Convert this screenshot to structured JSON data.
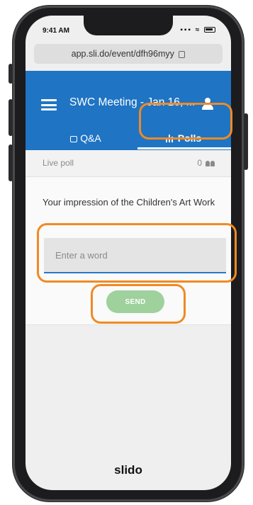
{
  "status_bar": {
    "time": "9:41 AM",
    "signal": "▪▪▪ ≈"
  },
  "browser": {
    "url": "app.sli.do/event/dfh96myy"
  },
  "header": {
    "event_title": "SWC Meeting - Jan 16, ...",
    "tabs": [
      {
        "label": "Q&A",
        "active": false
      },
      {
        "label": "Polls",
        "active": true
      }
    ]
  },
  "poll": {
    "live_label": "Live poll",
    "participant_count": "0",
    "question": "Your impression of the Children's Art Work",
    "input_placeholder": "Enter a word",
    "send_label": "SEND"
  },
  "footer": {
    "brand": "slido"
  },
  "colors": {
    "brand_blue": "#1f74c3",
    "send_green": "#9ed19c",
    "highlight_orange": "#f08a24",
    "input_underline": "#2878c8"
  }
}
